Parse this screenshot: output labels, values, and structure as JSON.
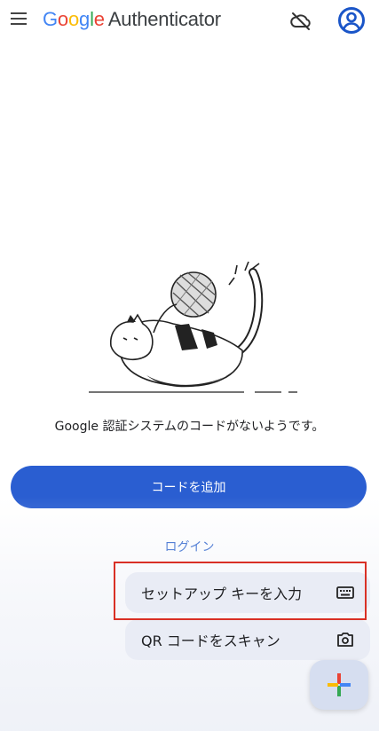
{
  "app_bar": {
    "brand_parts": [
      "G",
      "o",
      "o",
      "g",
      "l",
      "e"
    ],
    "app_name": "Authenticator",
    "icons": [
      "menu-icon",
      "cloud-off-icon",
      "account-circle-icon"
    ]
  },
  "empty_state": {
    "message": "Google 認証システムのコードがないようです。",
    "illustration": "cat-playing-with-yarn"
  },
  "actions": {
    "add_code_label": "コードを追加",
    "login_label": "ログイン"
  },
  "speed_dial": {
    "items": [
      {
        "label": "セットアップ キーを入力",
        "icon": "keyboard-icon"
      },
      {
        "label": "QR コードをスキャン",
        "icon": "camera-icon"
      }
    ],
    "fab_icon": "google-plus-icon"
  },
  "colors": {
    "primary": "#2a5ed1",
    "link": "#1a55c8",
    "highlight": "#d93025",
    "menu_bg": "#e9ecf5"
  }
}
